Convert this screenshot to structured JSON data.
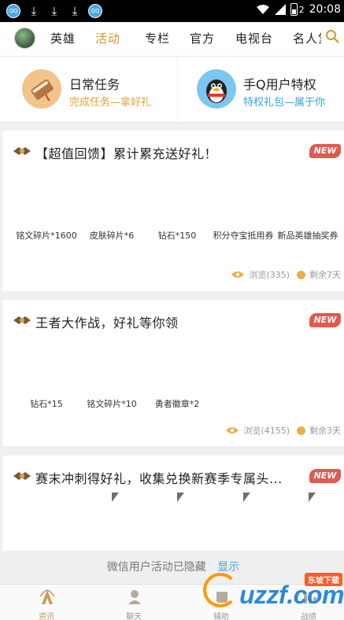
{
  "status_bar": {
    "time": "20:08",
    "battery_label": "2",
    "left_icons": [
      "app-circle-icon",
      "download-icon",
      "download-icon",
      "download-icon",
      "app-circle-icon"
    ],
    "app_icon_text": "QQ"
  },
  "nav": {
    "tabs": [
      "英雄",
      "活动",
      "专栏",
      "官方",
      "电视台",
      "名人堂"
    ],
    "active_tab": "活动",
    "accent_color": "#d4962c"
  },
  "quick_cards": [
    {
      "title": "日常任务",
      "subtitle": "完成任务—拿好礼",
      "subtitle_color": "#e5a13b"
    },
    {
      "title": "手Q用户特权",
      "subtitle": "特权礼包—属于你",
      "subtitle_color": "#3aa3e0"
    }
  ],
  "activities": [
    {
      "title": "【超值回馈】累计累充送好礼！",
      "badge": "NEW",
      "rewards": [
        "铭文碎片*1600",
        "皮肤碎片*6",
        "钻石*150",
        "积分夺宝抵用券",
        "新品英雄抽奖券"
      ],
      "views": "浏览(335)",
      "remaining": "剩余7天"
    },
    {
      "title": "王者大作战，好礼等你领",
      "badge": "NEW",
      "rewards": [
        "钻石*15",
        "铭文碎片*10",
        "勇者徽章*2"
      ],
      "views": "浏览(4155)",
      "remaining": "剩余3天"
    },
    {
      "title": "赛末冲刺得好礼，收集兑换新赛季专属头...",
      "badge": "NEW",
      "rewards": []
    }
  ],
  "hidden_notice": {
    "text": "微信用户活动已隐藏",
    "link": "显示"
  },
  "tabbar": {
    "tabs": [
      {
        "label": "资讯",
        "icon": "news-icon"
      },
      {
        "label": "聊天",
        "icon": "chat-icon"
      },
      {
        "label": "辅助",
        "icon": "assist-icon"
      },
      {
        "label": "战绩",
        "icon": "record-icon"
      }
    ],
    "active_tab": "资讯"
  },
  "watermark": {
    "text": "uzzf.com",
    "tag": "东坡下载"
  }
}
